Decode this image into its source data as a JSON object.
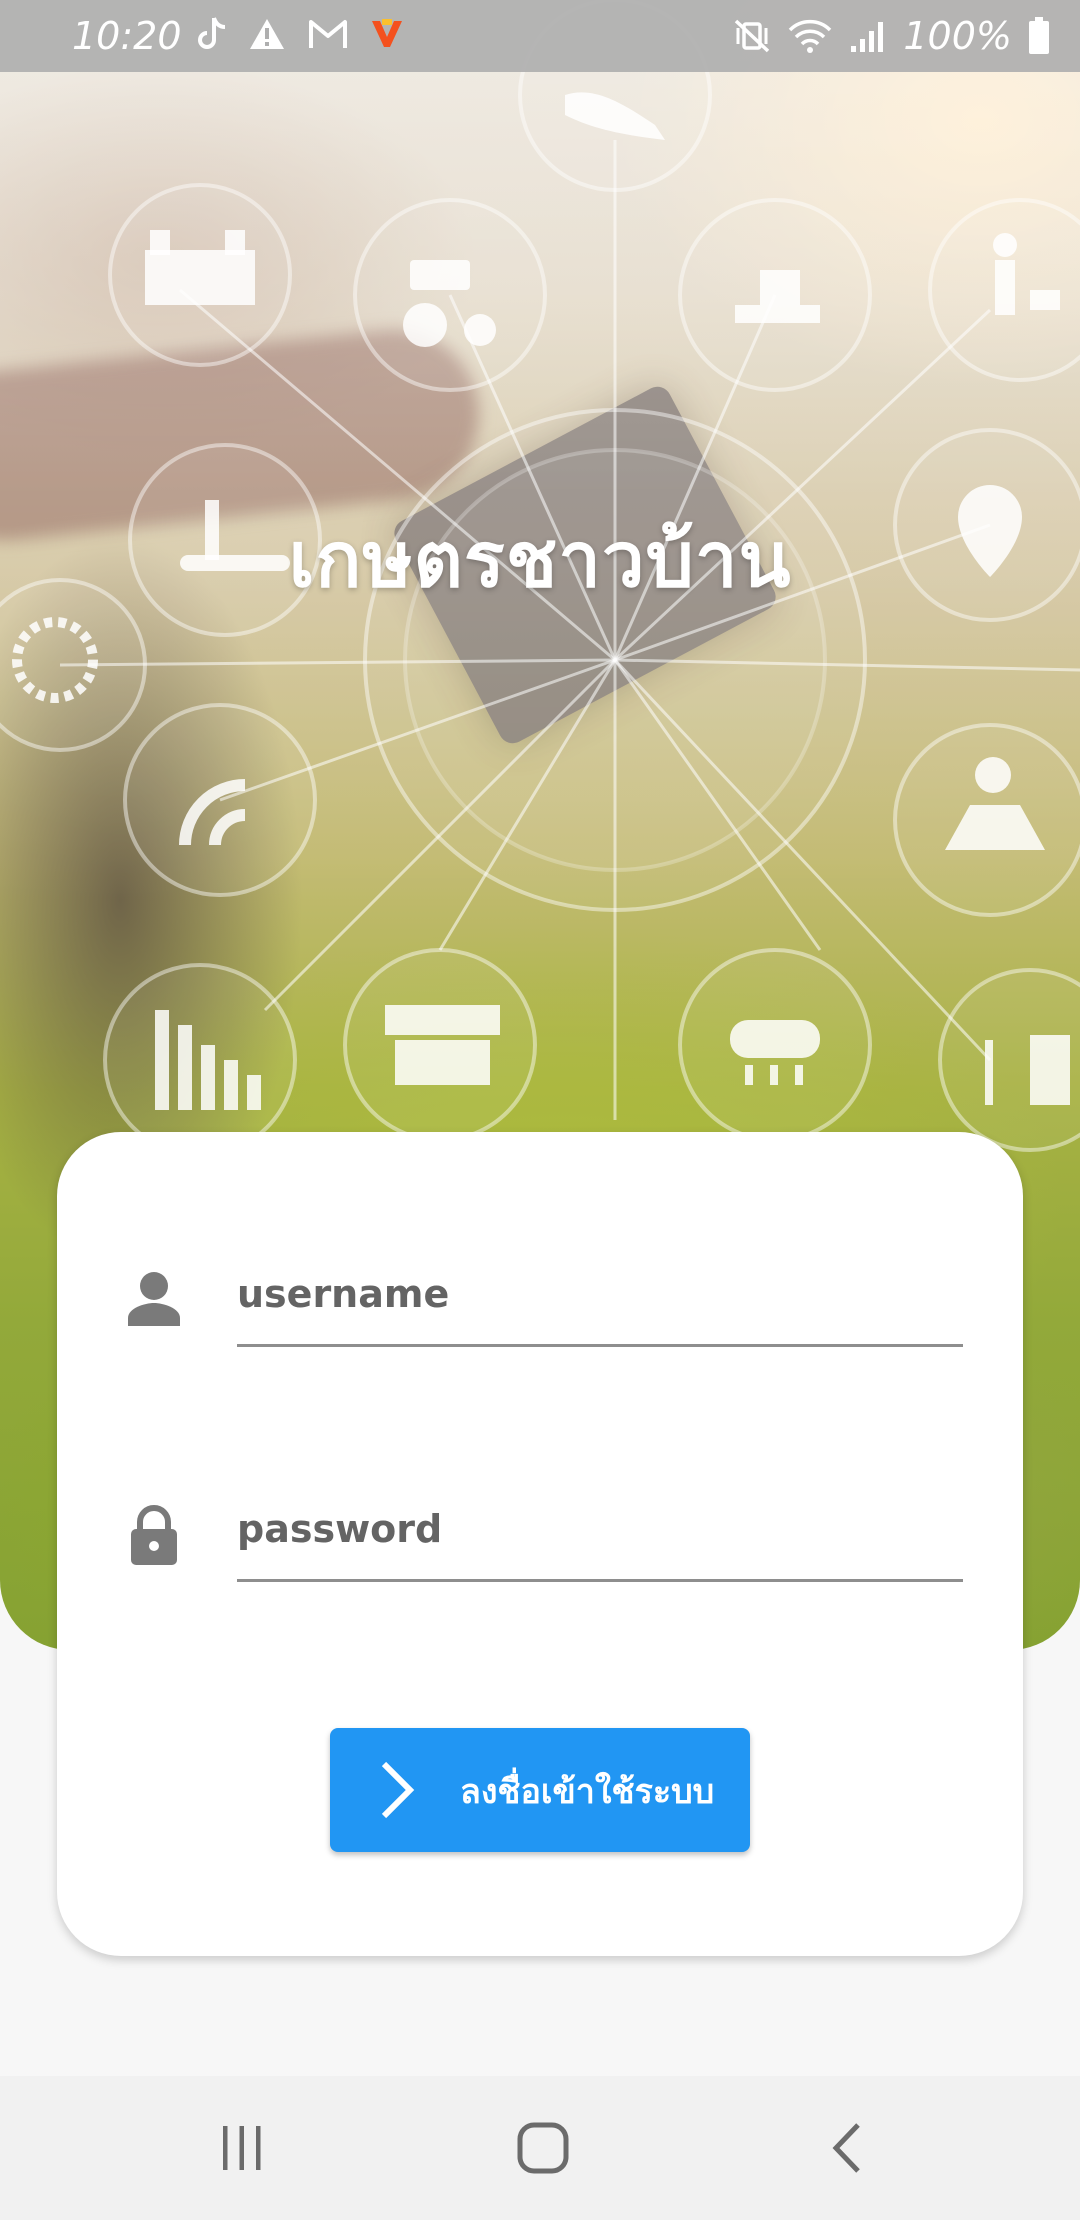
{
  "status_bar": {
    "time": "10:20",
    "battery_text": "100%",
    "notification_icons": [
      "tiktok-icon",
      "warning-icon",
      "gmail-icon",
      "app-icon"
    ],
    "system_icons": [
      "vibrate-mute-icon",
      "wifi-icon",
      "signal-icon",
      "battery-icon"
    ]
  },
  "hero": {
    "title": "เกษตรชาวบ้าน"
  },
  "login": {
    "username_placeholder": "username",
    "username_value": "",
    "password_placeholder": "password",
    "password_value": "",
    "button_label": "ลงชื่อเข้าใช้ระบบ"
  },
  "nav_bar": {
    "buttons": [
      "recent-apps",
      "home",
      "back"
    ]
  },
  "colors": {
    "accent": "#2196f3",
    "status_bar": "#afafaf",
    "card": "#ffffff",
    "field_text": "#646464",
    "icon_gray": "#7a7a7a"
  }
}
